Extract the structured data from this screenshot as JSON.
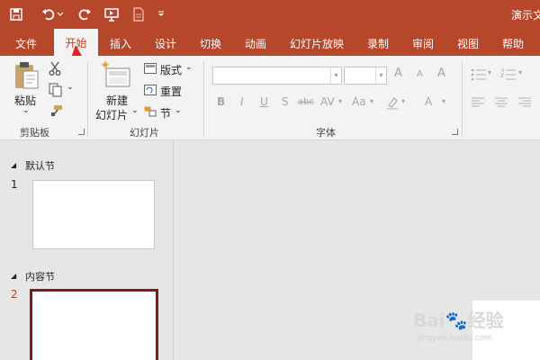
{
  "app": {
    "title": "演示文",
    "accent": "#b7472a",
    "qat_icons": [
      "save-icon",
      "undo-icon",
      "redo-icon",
      "present-icon",
      "new-file-icon",
      "customize-icon"
    ]
  },
  "tabs": [
    "文件",
    "开始",
    "插入",
    "设计",
    "切换",
    "动画",
    "幻灯片放映",
    "录制",
    "审阅",
    "视图",
    "帮助"
  ],
  "active_tab": "开始",
  "ribbon": {
    "clipboard": {
      "paste": "粘贴",
      "label": "剪贴板"
    },
    "slides": {
      "new_slide_l1": "新建",
      "new_slide_l2": "幻灯片",
      "layout": "版式",
      "reset": "重置",
      "section": "节",
      "label": "幻灯片"
    },
    "font": {
      "label": "字体",
      "bold": "B",
      "italic": "I",
      "underline": "U",
      "shadow": "S",
      "strike": "abc",
      "spacing": "AV",
      "case": "Aa",
      "grow": "A",
      "shrink": "A",
      "clear": "A"
    }
  },
  "slide_pane": {
    "sections": [
      {
        "name": "默认节",
        "slides": [
          {
            "number": "1",
            "selected": false
          }
        ]
      },
      {
        "name": "内容节",
        "slides": [
          {
            "number": "2",
            "selected": true
          }
        ]
      }
    ]
  },
  "watermark": {
    "brand": "Bai",
    "brand2": "经验",
    "url": "jingyan.baidu.com"
  }
}
